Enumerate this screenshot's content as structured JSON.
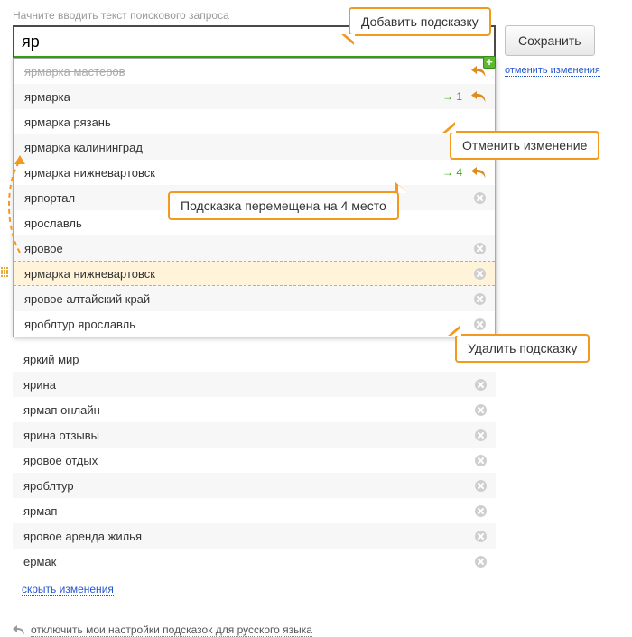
{
  "hint_label": "Начните вводить текст поискового запроса",
  "search_value": "яр",
  "save_label": "Сохранить",
  "cancel_label": "отменить изменения",
  "callouts": {
    "add": "Добавить подсказку",
    "undo": "Отменить изменение",
    "moved": "Подсказка перемещена на 4 место",
    "delete": "Удалить подсказку"
  },
  "inner_rows": [
    {
      "label": "ярмарка мастеров",
      "struck": true,
      "undo": true
    },
    {
      "label": "ярмарка",
      "move": "1",
      "undo": true
    },
    {
      "label": "ярмарка рязань"
    },
    {
      "label": "ярмарка калининград"
    },
    {
      "label": "ярмарка нижневартовск",
      "move": "4",
      "undo": true
    },
    {
      "label": "ярпортал",
      "del": true
    },
    {
      "label": "ярославль"
    },
    {
      "label": "яровое",
      "del": true
    },
    {
      "label": "ярмарка нижневартовск",
      "highlight": true,
      "del": true,
      "drag": true
    },
    {
      "label": "яровое алтайский край",
      "del": true
    },
    {
      "label": "яроблтур ярославль",
      "del": true
    }
  ],
  "outer_rows": [
    {
      "label": "яркий мир"
    },
    {
      "label": "ярина",
      "del": true
    },
    {
      "label": "ярмап онлайн",
      "del": true
    },
    {
      "label": "ярина отзывы",
      "del": true
    },
    {
      "label": "яровое отдых",
      "del": true
    },
    {
      "label": "яроблтур",
      "del": true
    },
    {
      "label": "ярмап",
      "del": true
    },
    {
      "label": "яровое аренда жилья",
      "del": true
    },
    {
      "label": "ермак",
      "del": true
    }
  ],
  "show_changes": "скрыть изменения",
  "footer": "отключить мои настройки подсказок для русского языка"
}
